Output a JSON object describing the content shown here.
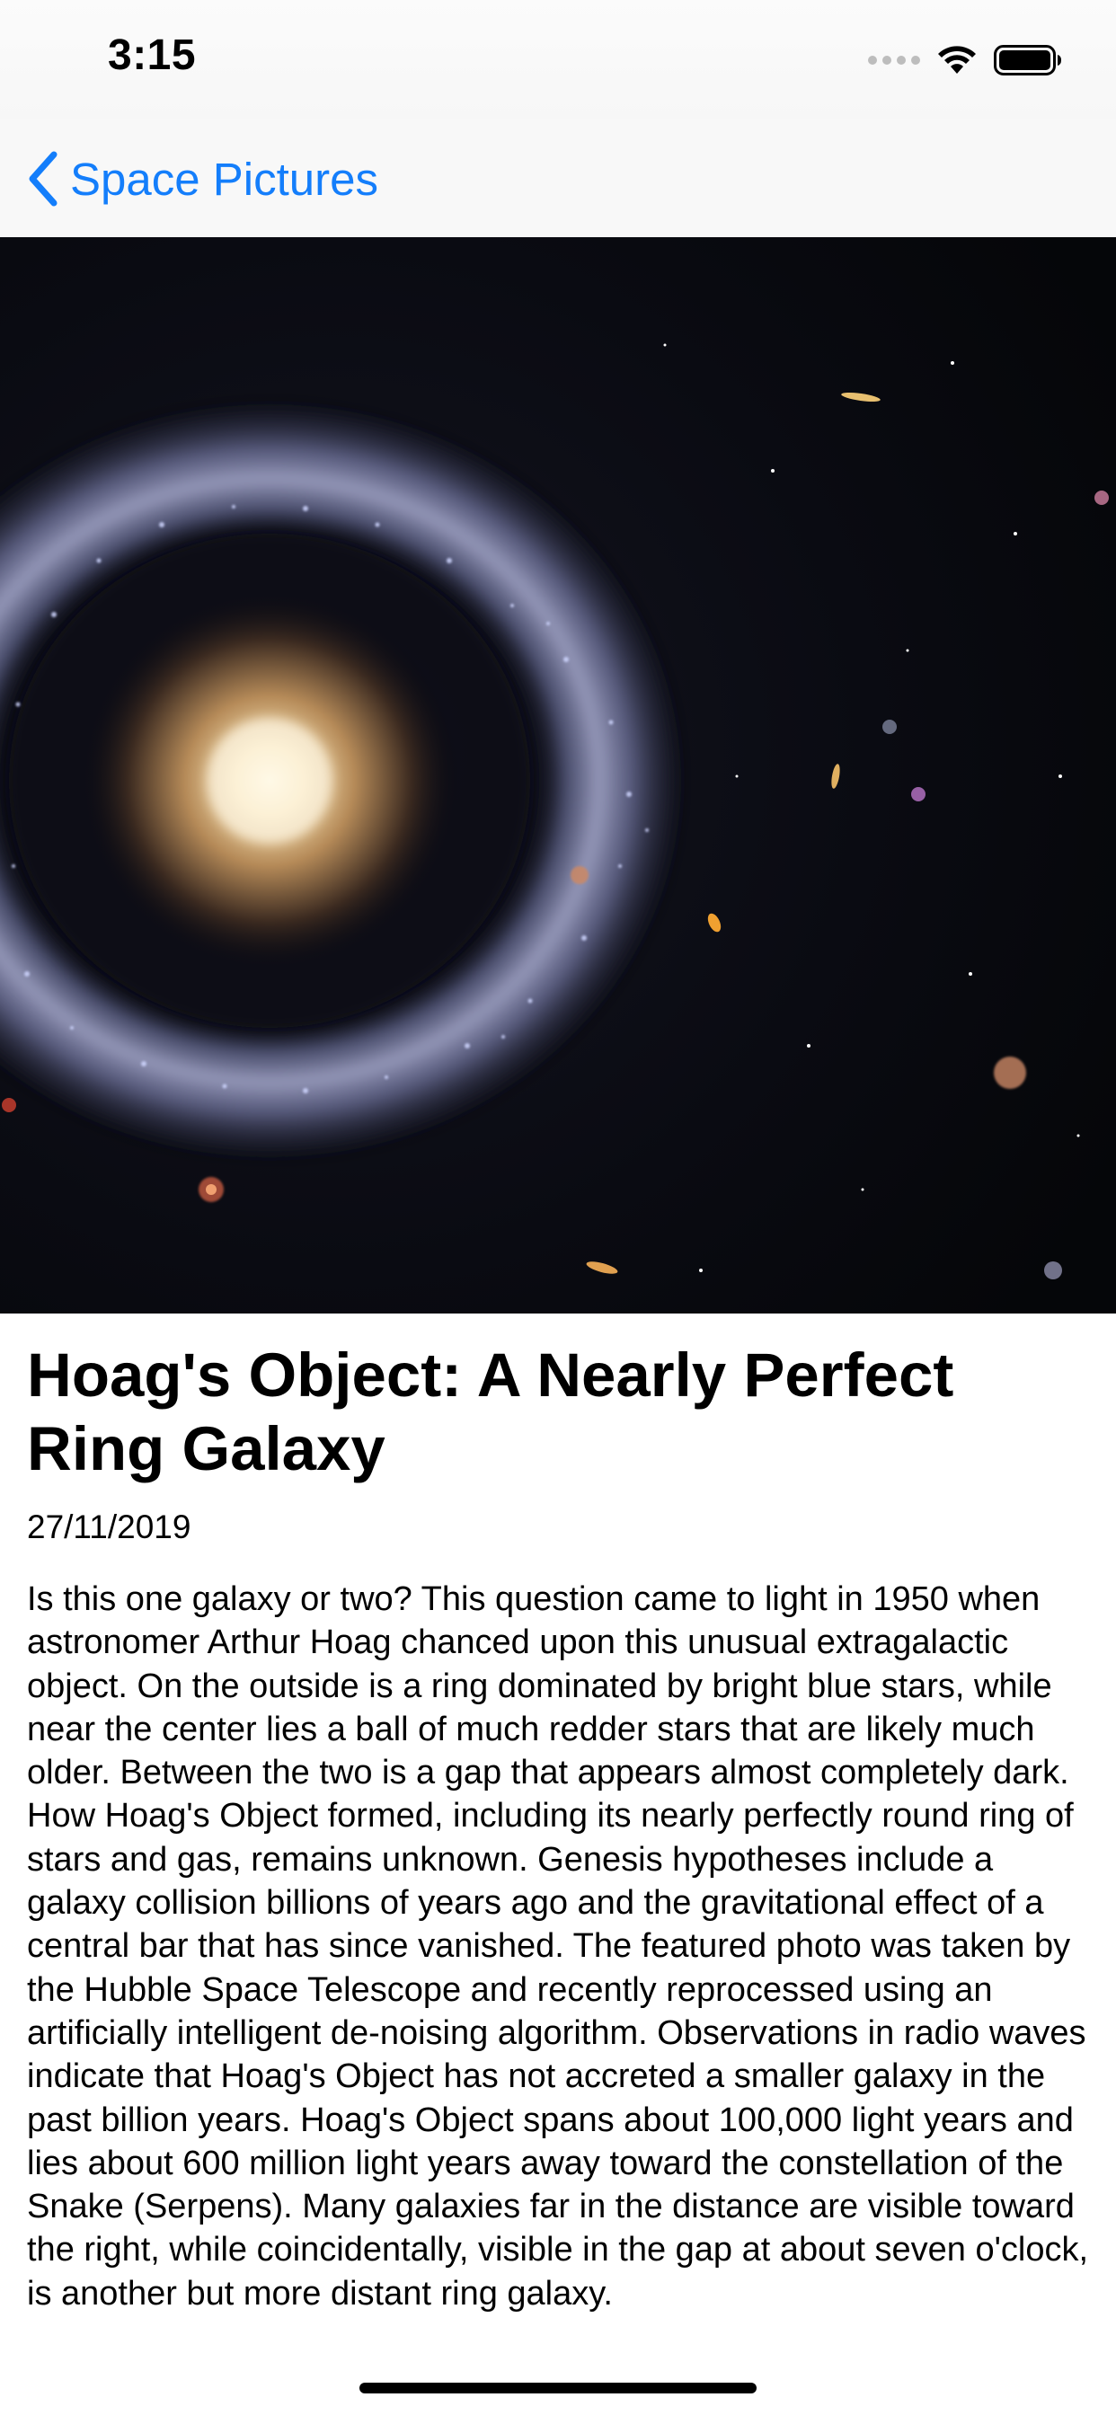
{
  "status_bar": {
    "time": "3:15",
    "icons": [
      "signal-dots-icon",
      "wifi-icon",
      "battery-icon"
    ]
  },
  "nav": {
    "back_label": "Space Pictures",
    "back_icon": "chevron-left-icon",
    "accent_color": "#147efb"
  },
  "article": {
    "title": "Hoag's Object: A Nearly Perfect Ring Galaxy",
    "date": "27/11/2019",
    "description": "Is this one galaxy or two?  This question came to light in 1950 when astronomer Arthur Hoag chanced upon this unusual extragalactic object.  On the outside is a ring dominated by bright blue stars, while near the center lies a ball of much redder stars that are likely much older.  Between the two is a gap that appears almost completely dark.  How Hoag's Object formed, including its nearly perfectly round ring of stars and gas, remains unknown.  Genesis hypotheses include a galaxy collision billions of years ago and the gravitational effect of a central bar that has since vanished. The featured photo was taken by the Hubble Space Telescope and recently reprocessed using an artificially intelligent de-noising algorithm.  Observations in radio waves indicate that Hoag's Object has not accreted a smaller galaxy in the past billion years.  Hoag's Object spans about 100,000 light years and lies about 600 million light years away toward the constellation of the Snake (Serpens).  Many galaxies far in the distance are visible toward the right, while coincidentally, visible in the gap at about seven o'clock, is another but more distant ring galaxy."
  }
}
